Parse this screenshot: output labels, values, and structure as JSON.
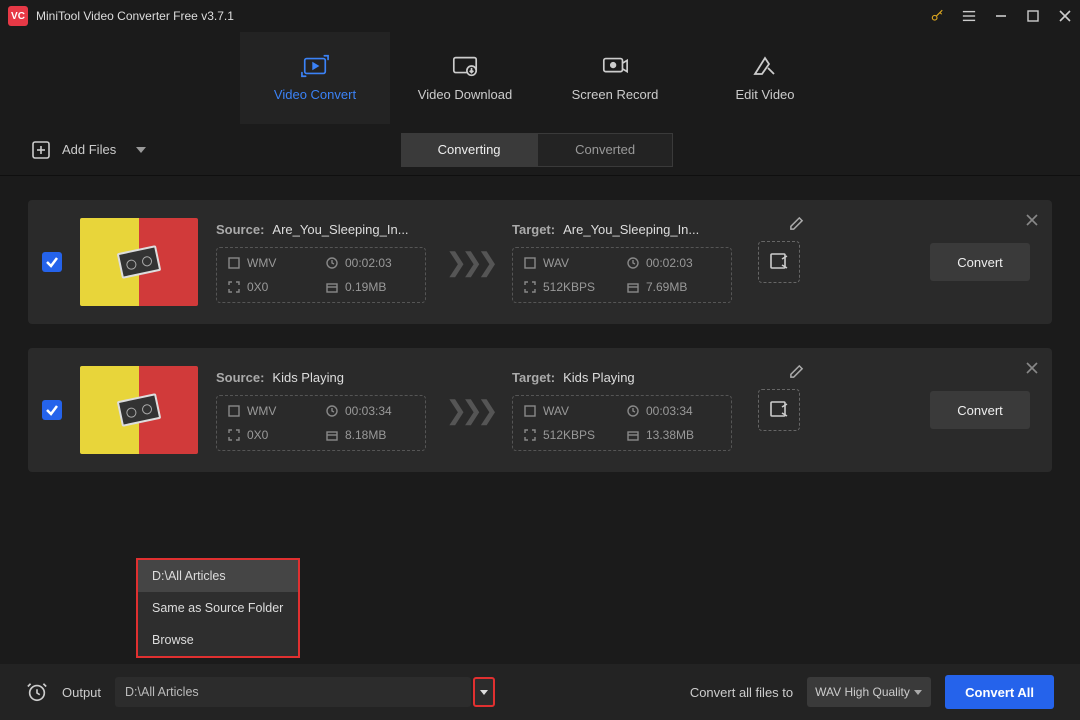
{
  "app": {
    "title": "MiniTool Video Converter Free v3.7.1"
  },
  "mainTabs": [
    {
      "label": "Video Convert",
      "active": true
    },
    {
      "label": "Video Download",
      "active": false
    },
    {
      "label": "Screen Record",
      "active": false
    },
    {
      "label": "Edit Video",
      "active": false
    }
  ],
  "toolbar": {
    "addFiles": "Add Files"
  },
  "subTabs": {
    "converting": "Converting",
    "converted": "Converted"
  },
  "labels": {
    "source": "Source:",
    "target": "Target:",
    "convert": "Convert"
  },
  "files": [
    {
      "sourceName": "Are_You_Sleeping_In...",
      "targetName": "Are_You_Sleeping_In...",
      "src": {
        "fmt": "WMV",
        "dur": "00:02:03",
        "res": "0X0",
        "size": "0.19MB"
      },
      "tgt": {
        "fmt": "WAV",
        "dur": "00:02:03",
        "rate": "512KBPS",
        "size": "7.69MB"
      },
      "thumb": {
        "c1": "#e8d53a",
        "c2": "#d13a3a"
      }
    },
    {
      "sourceName": "Kids Playing",
      "targetName": "Kids Playing",
      "src": {
        "fmt": "WMV",
        "dur": "00:03:34",
        "res": "0X0",
        "size": "8.18MB"
      },
      "tgt": {
        "fmt": "WAV",
        "dur": "00:03:34",
        "rate": "512KBPS",
        "size": "13.38MB"
      },
      "thumb": {
        "c1": "#e8d53a",
        "c2": "#d13a3a"
      }
    }
  ],
  "outputMenu": {
    "items": [
      "D:\\All Articles",
      "Same as Source Folder",
      "Browse"
    ],
    "hoverIndex": 0
  },
  "bottom": {
    "outputLabel": "Output",
    "outputPath": "D:\\All Articles",
    "convertAllLabel": "Convert all files to",
    "formatSelected": "WAV High Quality",
    "convertAllBtn": "Convert All"
  }
}
